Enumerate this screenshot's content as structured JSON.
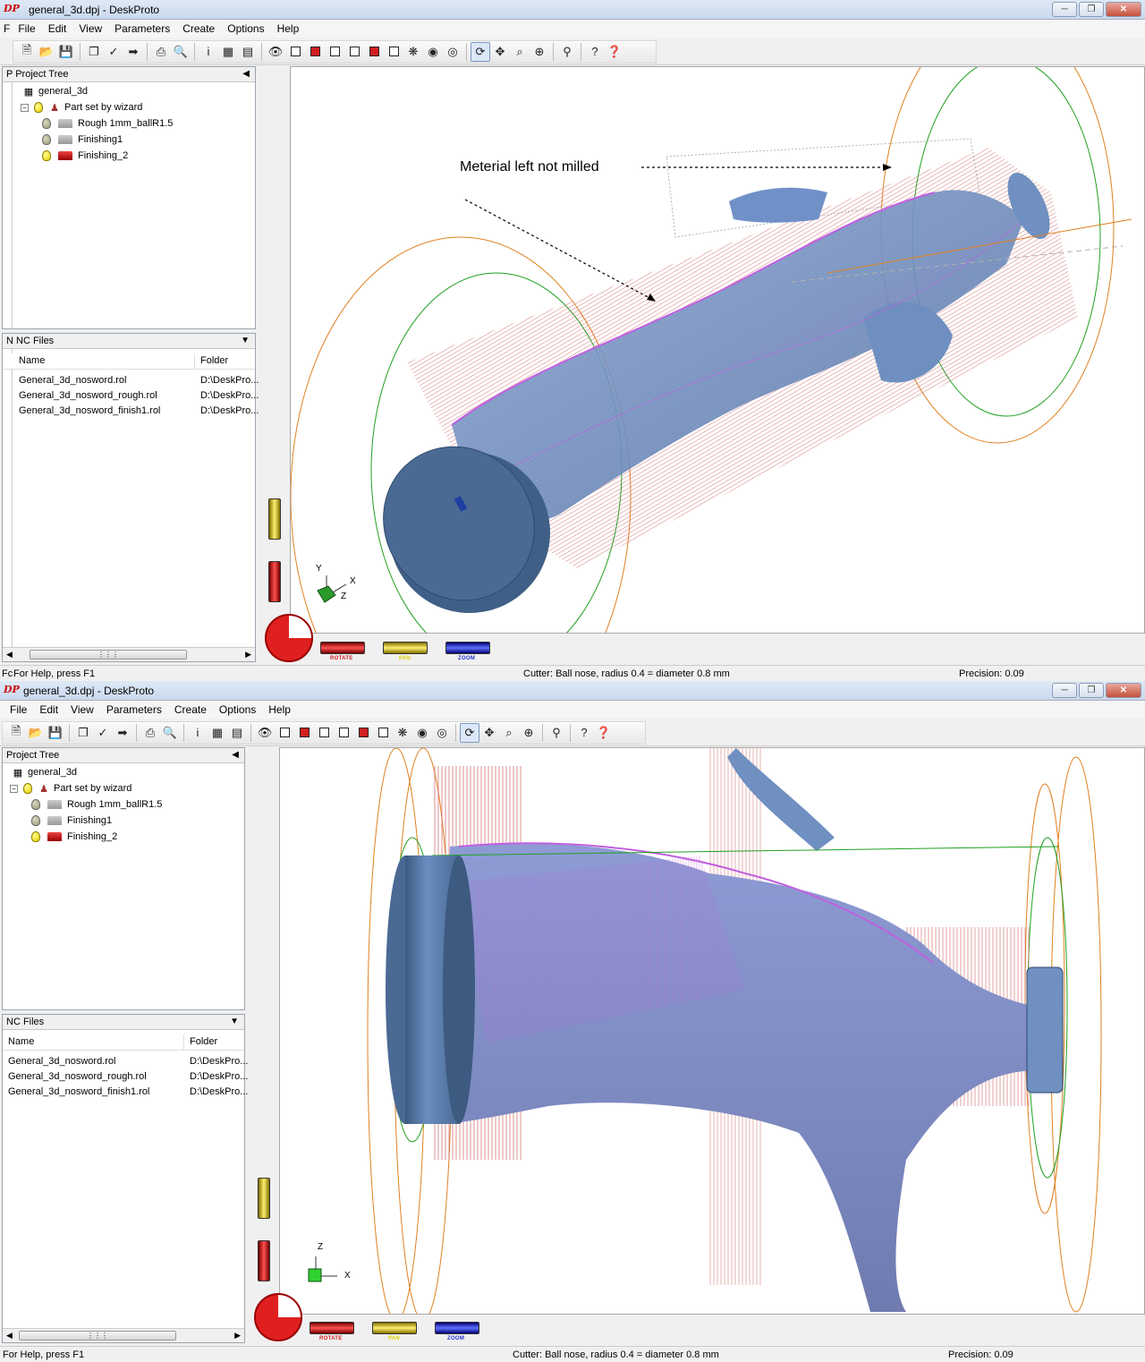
{
  "colors": {
    "titlebar": "#dfe9f5",
    "model_blue": "#6f90c0",
    "toolpath_red": "#d06060",
    "toolpath_purple": "#c060e0",
    "boundary_orange": "#e08020",
    "boundary_green": "#20a020",
    "rotate_wheel": "#d02020",
    "pan_wheel": "#e0d000",
    "zoom_wheel": "#2030d0"
  },
  "windows": [
    {
      "title": "general_3d.dpj - DeskProto",
      "menu": [
        "File",
        "Edit",
        "View",
        "Parameters",
        "Create",
        "Options",
        "Help"
      ],
      "menu_prefix": "F",
      "project_tree": {
        "header": "Project Tree",
        "header_prefix": "P",
        "root": "general_3d",
        "part": "Part set by wizard",
        "operations": [
          {
            "label": "Rough 1mm_ballR1.5",
            "enabled": false
          },
          {
            "label": "Finishing1",
            "enabled": false
          },
          {
            "label": "Finishing_2",
            "enabled": true
          }
        ]
      },
      "nc_files": {
        "header": "NC Files",
        "header_prefix": "N",
        "col_name": "Name",
        "col_folder": "Folder",
        "rows": [
          {
            "name": "General_3d_nosword.rol",
            "folder": "D:\\DeskPro..."
          },
          {
            "name": "General_3d_nosword_rough.rol",
            "folder": "D:\\DeskPro..."
          },
          {
            "name": "General_3d_nosword_finish1.rol",
            "folder": "D:\\DeskPro..."
          }
        ]
      },
      "annotation": "Meterial left not milled",
      "axis_labels": {
        "a": "Y",
        "b": "X",
        "c": "Z"
      },
      "wheels": {
        "rotate": "ROTATE",
        "pan": "PAN",
        "zoom": "ZOOM"
      },
      "status": {
        "prefix": "Fc",
        "help": "For Help, press F1",
        "cutter": "Cutter: Ball nose, radius 0.4 = diameter 0.8 mm",
        "precision": "Precision: 0.09"
      }
    },
    {
      "title": "general_3d.dpj - DeskProto",
      "menu": [
        "File",
        "Edit",
        "View",
        "Parameters",
        "Create",
        "Options",
        "Help"
      ],
      "menu_prefix": "",
      "project_tree": {
        "header": "Project Tree",
        "header_prefix": "",
        "root": "general_3d",
        "part": "Part set by wizard",
        "operations": [
          {
            "label": "Rough 1mm_ballR1.5",
            "enabled": false
          },
          {
            "label": "Finishing1",
            "enabled": false
          },
          {
            "label": "Finishing_2",
            "enabled": true
          }
        ]
      },
      "nc_files": {
        "header": "NC Files",
        "header_prefix": "",
        "col_name": "Name",
        "col_folder": "Folder",
        "rows": [
          {
            "name": "General_3d_nosword.rol",
            "folder": "D:\\DeskPro..."
          },
          {
            "name": "General_3d_nosword_rough.rol",
            "folder": "D:\\DeskPro..."
          },
          {
            "name": "General_3d_nosword_finish1.rol",
            "folder": "D:\\DeskPro..."
          }
        ]
      },
      "axis_labels": {
        "a": "Z",
        "b": "X"
      },
      "wheels": {
        "rotate": "ROTATE",
        "pan": "PAN",
        "zoom": "ZOOM"
      },
      "status": {
        "prefix": "",
        "help": "For Help, press F1",
        "cutter": "Cutter: Ball nose, radius 0.4 = diameter 0.8 mm",
        "precision": "Precision: 0.09"
      }
    }
  ],
  "toolbar_icons": [
    "new-file-icon",
    "open-folder-icon",
    "save-icon",
    "new-part-icon",
    "new-operation-icon",
    "export-icon",
    "print-icon",
    "print-preview-icon",
    "info-icon",
    "grid-icon",
    "properties-icon",
    "visibility-icon",
    "view-cube-icon",
    "view-front-icon",
    "view-back-icon",
    "view-left-icon",
    "view-right-icon",
    "view-top-icon",
    "view-iso-icon",
    "view-default-icon",
    "view-eye-icon",
    "rotate-view-icon",
    "pan-view-icon",
    "zoom-window-icon",
    "zoom-in-icon",
    "zoom-100-icon",
    "help-icon",
    "context-help-icon"
  ]
}
